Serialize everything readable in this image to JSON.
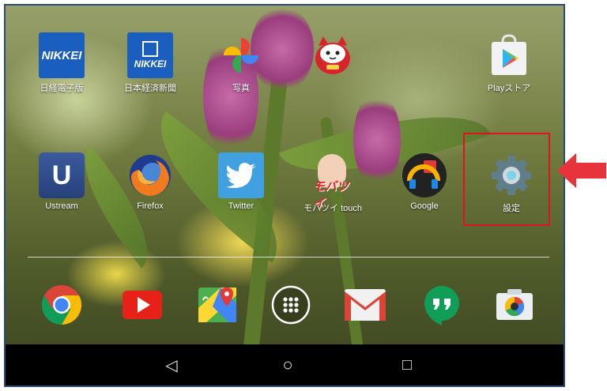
{
  "home_screen": {
    "row1": [
      {
        "label": "日経電子版",
        "icon": "nikkei-icon",
        "logo_text": "NIKKEI"
      },
      {
        "label": "日本経済新聞",
        "icon": "nikkei-paper-icon",
        "logo_text": "NIKKEI"
      },
      {
        "label": "写真",
        "icon": "photos-pinwheel-icon"
      },
      {
        "label": "",
        "icon": "daruma-cat-icon"
      },
      {
        "label": "Playストア",
        "icon": "play-store-icon"
      }
    ],
    "row2": [
      {
        "label": "Ustream",
        "icon": "ustream-icon",
        "logo_text": "U"
      },
      {
        "label": "Firefox",
        "icon": "firefox-icon"
      },
      {
        "label": "Twitter",
        "icon": "twitter-bird-icon"
      },
      {
        "label": "モバツイ touch",
        "icon": "mobatsui-icon",
        "logo_text": "モバツイ"
      },
      {
        "label": "Google",
        "icon": "google-folder-icon"
      },
      {
        "label": "設定",
        "icon": "settings-gear-icon"
      }
    ],
    "dock": [
      {
        "icon": "chrome-icon"
      },
      {
        "icon": "youtube-icon"
      },
      {
        "icon": "maps-icon"
      },
      {
        "icon": "app-drawer-icon"
      },
      {
        "icon": "gmail-icon"
      },
      {
        "icon": "hangouts-icon"
      },
      {
        "icon": "camera-icon"
      }
    ]
  },
  "nav_bar": {
    "back": "◁",
    "home": "○",
    "recents": "□"
  },
  "annotation": {
    "highlight_color": "#e0141e",
    "arrow_color": "#e8323c"
  }
}
